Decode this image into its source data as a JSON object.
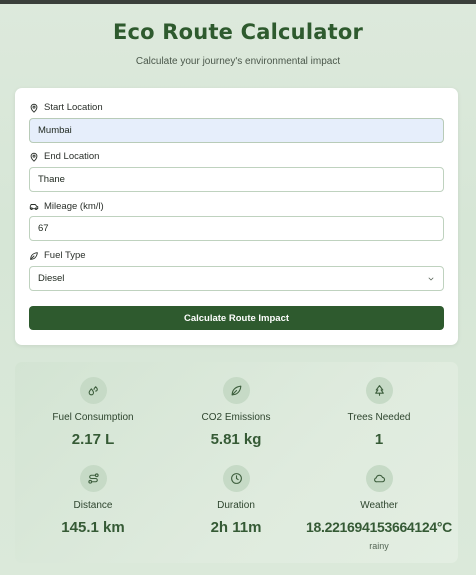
{
  "header": {
    "title": "Eco Route Calculator",
    "subtitle": "Calculate your journey's environmental impact"
  },
  "form": {
    "start_label": "Start Location",
    "start_value": "Mumbai",
    "end_label": "End Location",
    "end_value": "Thane",
    "mileage_label": "Mileage (km/l)",
    "mileage_value": "67",
    "fuel_label": "Fuel Type",
    "fuel_value": "Diesel",
    "submit_label": "Calculate Route Impact"
  },
  "results": {
    "fuel": {
      "label": "Fuel Consumption",
      "value": "2.17 L",
      "icon": "droplets-icon"
    },
    "co2": {
      "label": "CO2 Emissions",
      "value": "5.81 kg",
      "icon": "leaf-icon"
    },
    "trees": {
      "label": "Trees Needed",
      "value": "1",
      "icon": "tree-icon"
    },
    "distance": {
      "label": "Distance",
      "value": "145.1 km",
      "icon": "route-icon"
    },
    "duration": {
      "label": "Duration",
      "value": "2h 11m",
      "icon": "clock-icon"
    },
    "weather": {
      "label": "Weather",
      "value": "18.221694153664124°C",
      "sub": "rainy",
      "icon": "cloud-icon"
    }
  },
  "colors": {
    "primary": "#2e5a2e",
    "background": "#d6e6d6",
    "accent_value": "#355a35"
  }
}
